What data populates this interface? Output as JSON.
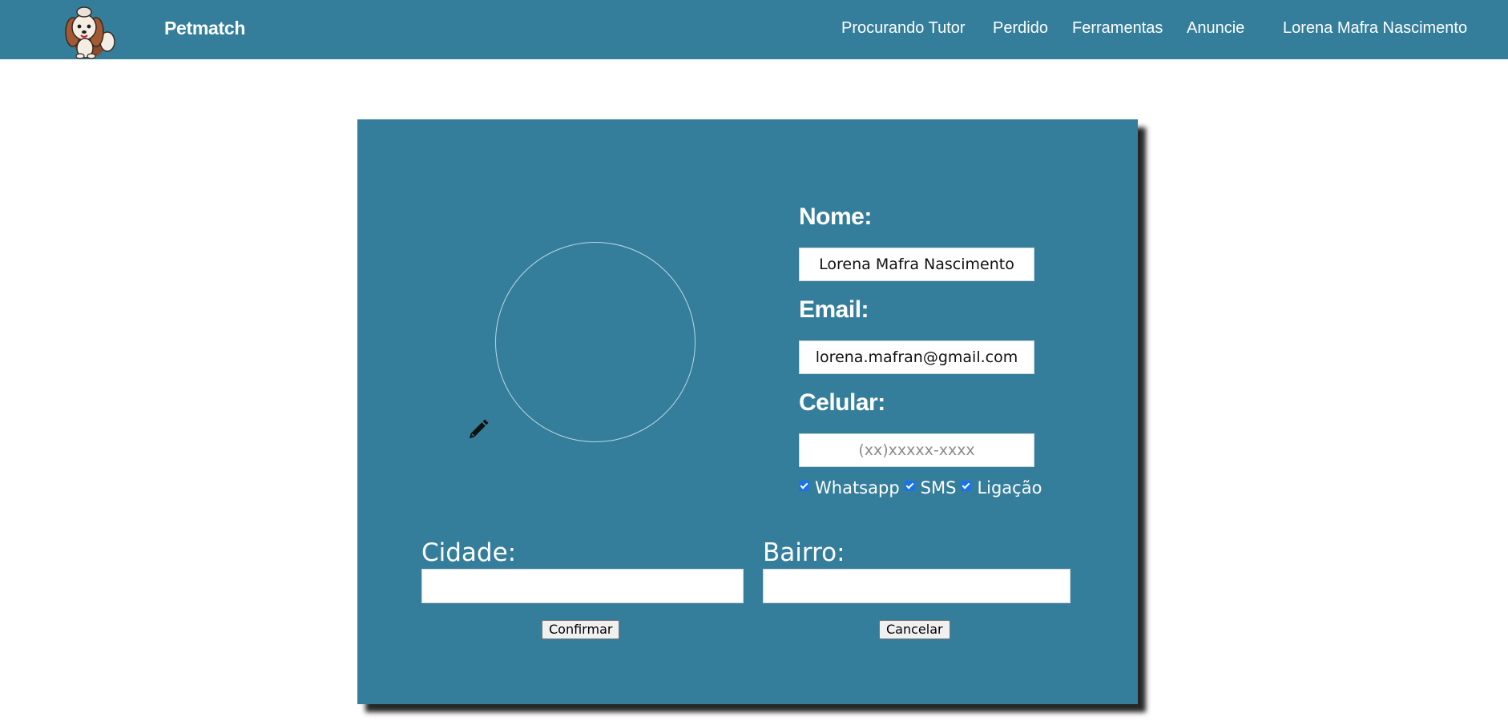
{
  "header": {
    "brand": "Petmatch",
    "nav": [
      "Procurando Tutor",
      "Perdido",
      "Ferramentas",
      "Anuncie"
    ],
    "user_name": "Lorena Mafra Nascimento"
  },
  "profile": {
    "name_label": "Nome:",
    "name_value": "Lorena Mafra Nascimento",
    "email_label": "Email:",
    "email_value": "lorena.mafran@gmail.com",
    "phone_label": "Celular:",
    "phone_placeholder": "(xx)xxxxx-xxxx",
    "contact_options": [
      {
        "label": "Whatsapp",
        "checked": true
      },
      {
        "label": "SMS",
        "checked": true
      },
      {
        "label": "Ligação",
        "checked": true
      }
    ],
    "city_label": "Cidade:",
    "city_value": "",
    "district_label": "Bairro:",
    "district_value": "",
    "confirm_label": "Confirmar",
    "cancel_label": "Cancelar"
  },
  "colors": {
    "primary": "#347e9c",
    "checkbox": "#1a73e8"
  }
}
